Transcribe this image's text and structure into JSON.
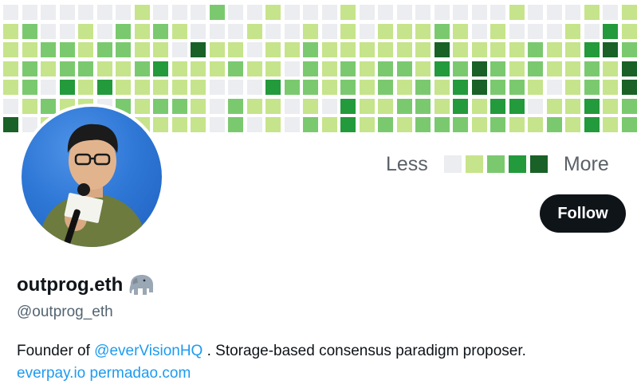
{
  "banner": {
    "palette": [
      "#ebedf0",
      "#c6e48b",
      "#7bc96f",
      "#239a3b",
      "#196127"
    ],
    "grid": [
      [
        0,
        0,
        0,
        0,
        0,
        0,
        0,
        1,
        0,
        0,
        0,
        2,
        0,
        0,
        1,
        0,
        0,
        0,
        1,
        0,
        0,
        0,
        0,
        0,
        0,
        0,
        0,
        1,
        0,
        0,
        0,
        1,
        0,
        1
      ],
      [
        1,
        2,
        0,
        0,
        1,
        0,
        2,
        1,
        2,
        1,
        0,
        0,
        0,
        1,
        0,
        0,
        1,
        0,
        1,
        0,
        1,
        1,
        1,
        2,
        1,
        0,
        1,
        0,
        0,
        0,
        1,
        0,
        3,
        1
      ],
      [
        1,
        1,
        2,
        2,
        1,
        2,
        2,
        1,
        1,
        0,
        4,
        1,
        1,
        0,
        1,
        1,
        2,
        1,
        1,
        1,
        1,
        1,
        1,
        4,
        1,
        1,
        1,
        1,
        2,
        1,
        1,
        3,
        4,
        2
      ],
      [
        1,
        2,
        1,
        2,
        2,
        1,
        1,
        2,
        3,
        1,
        1,
        1,
        2,
        1,
        1,
        0,
        2,
        1,
        2,
        1,
        2,
        2,
        1,
        3,
        2,
        4,
        2,
        1,
        2,
        1,
        1,
        2,
        1,
        4
      ],
      [
        1,
        2,
        0,
        3,
        1,
        3,
        1,
        1,
        1,
        1,
        1,
        0,
        0,
        0,
        3,
        2,
        2,
        1,
        2,
        1,
        2,
        1,
        2,
        1,
        3,
        4,
        2,
        2,
        1,
        0,
        1,
        2,
        1,
        4
      ],
      [
        0,
        1,
        2,
        1,
        1,
        0,
        2,
        1,
        2,
        2,
        1,
        0,
        2,
        1,
        1,
        0,
        1,
        0,
        3,
        1,
        1,
        2,
        2,
        1,
        3,
        1,
        3,
        3,
        0,
        1,
        1,
        3,
        1,
        2
      ],
      [
        4,
        0,
        1,
        2,
        1,
        2,
        1,
        1,
        1,
        1,
        1,
        0,
        2,
        0,
        1,
        0,
        2,
        1,
        3,
        1,
        2,
        1,
        2,
        2,
        2,
        1,
        2,
        1,
        1,
        2,
        1,
        3,
        1,
        2
      ]
    ]
  },
  "legend": {
    "less_label": "Less",
    "more_label": "More",
    "levels": [
      "#ebedf0",
      "#c6e48b",
      "#7bc96f",
      "#239a3b",
      "#196127"
    ]
  },
  "profile": {
    "display_name": "outprog.eth",
    "badge_icon": "elephant-emoji",
    "handle": "@outprog_eth",
    "follow_label": "Follow",
    "bio": {
      "prefix": "Founder of ",
      "mention": "@everVisionHQ",
      "suffix": " . Storage-based consensus paradigm proposer."
    },
    "links": [
      "everpay.io",
      "permadao.com"
    ]
  },
  "colors": {
    "link": "#1d9bf0",
    "follow_bg": "#0f1419",
    "secondary_text": "#536471"
  }
}
